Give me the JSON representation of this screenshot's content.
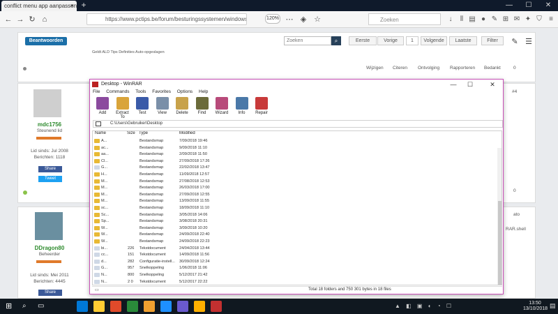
{
  "browser": {
    "tab_title": "conflict menu app aanpassen w...",
    "tab_close": "×",
    "new_tab": "+",
    "url": "https://www.pctips.be/forum/besturingssystemen/windows-8/...",
    "zoom": "120%",
    "search_placeholder": "Zoeken",
    "window_controls": [
      "—",
      "☐",
      "✕"
    ]
  },
  "forum": {
    "reply_button": "Beantwoorden",
    "search_placeholder": "Zoeken",
    "search_btn": "⌕",
    "nav": [
      "Eerste",
      "Vorige",
      "1",
      "Volgende",
      "Laatste"
    ],
    "filter": "Filter",
    "post_small_text": "Geldt ALD Tips Definities Auto-opgeslagen",
    "actions": [
      "Wijzigen",
      "Citeren",
      "Ontvolging",
      "Rapporteren",
      "Bedankt"
    ],
    "bedankt_count": "0",
    "users": [
      {
        "name": "mdc1756",
        "role": "Steunend lid",
        "since": "Lid sinds: Jul 2008",
        "posts": "Berichten: 1118",
        "share": "Share",
        "tweet": "Tweet"
      },
      {
        "name": "DDragon80",
        "role": "Beheerder",
        "since": "Lid sinds: Mei 2011",
        "posts": "Berichten: 4445",
        "share": "Share"
      }
    ],
    "post_number": "#4",
    "side_count": "0",
    "side_text_1": "ato",
    "side_text_2": "RAR.shell"
  },
  "winrar": {
    "title": "Desktop - WinRAR",
    "menu": [
      "File",
      "Commands",
      "Tools",
      "Favorites",
      "Options",
      "Help"
    ],
    "toolbar": [
      "Add",
      "Extract To",
      "Test",
      "View",
      "Delete",
      "Find",
      "Wizard",
      "Info",
      "Repair"
    ],
    "toolbar_colors": [
      "#8b4a9e",
      "#d9a43a",
      "#3a5aa8",
      "#7a8fa8",
      "#c8a24a",
      "#6b6b3a",
      "#b84a7a",
      "#4a78a8",
      "#c83a3a"
    ],
    "address": "C:\\Users\\Gebruiker\\Desktop",
    "columns": [
      "Name",
      "Size",
      "Type",
      "Modified"
    ],
    "files": [
      {
        "name": "A...",
        "size": "",
        "type": "Bestandsmap",
        "modified": "7/09/2018 19:46",
        "kind": "folder"
      },
      {
        "name": "ac...",
        "size": "",
        "type": "Bestandsmap",
        "modified": "9/09/2018 11:10",
        "kind": "folder"
      },
      {
        "name": "aa...",
        "size": "",
        "type": "Bestandsmap",
        "modified": "2/09/2018 11:50",
        "kind": "folder"
      },
      {
        "name": "Cl...",
        "size": "",
        "type": "Bestandsmap",
        "modified": "27/09/2018 17:26",
        "kind": "folder"
      },
      {
        "name": "G...",
        "size": "",
        "type": "Bestandsmap",
        "modified": "22/02/2018 13:47",
        "kind": "doc"
      },
      {
        "name": "H...",
        "size": "",
        "type": "Bestandsmap",
        "modified": "11/09/2018 12:57",
        "kind": "folder"
      },
      {
        "name": "M...",
        "size": "",
        "type": "Bestandsmap",
        "modified": "27/08/2018 12:53",
        "kind": "folder"
      },
      {
        "name": "M...",
        "size": "",
        "type": "Bestandsmap",
        "modified": "26/03/2018 17:00",
        "kind": "folder"
      },
      {
        "name": "M...",
        "size": "",
        "type": "Bestandsmap",
        "modified": "27/09/2018 12:55",
        "kind": "folder"
      },
      {
        "name": "M...",
        "size": "",
        "type": "Bestandsmap",
        "modified": "13/09/2018 11:55",
        "kind": "folder"
      },
      {
        "name": "sc...",
        "size": "",
        "type": "Bestandsmap",
        "modified": "18/09/2018 11:10",
        "kind": "folder"
      },
      {
        "name": "Sc...",
        "size": "",
        "type": "Bestandsmap",
        "modified": "3/05/2018 14:06",
        "kind": "folder"
      },
      {
        "name": "Sp...",
        "size": "",
        "type": "Bestandsmap",
        "modified": "3/08/2018 20:31",
        "kind": "folder"
      },
      {
        "name": "W...",
        "size": "",
        "type": "Bestandsmap",
        "modified": "3/09/2018 10:20",
        "kind": "folder"
      },
      {
        "name": "W...",
        "size": "",
        "type": "Bestandsmap",
        "modified": "24/09/2018 22:40",
        "kind": "folder"
      },
      {
        "name": "W...",
        "size": "",
        "type": "Bestandsmap",
        "modified": "24/09/2018 22:23",
        "kind": "folder"
      },
      {
        "name": "bi...",
        "size": "226",
        "type": "Tekstdocument",
        "modified": "24/04/2018 13:44",
        "kind": "doc"
      },
      {
        "name": "cc...",
        "size": "151",
        "type": "Tekstdocument",
        "modified": "14/09/2018 11:56",
        "kind": "doc"
      },
      {
        "name": "d...",
        "size": "282",
        "type": "Configuratie-instell...",
        "modified": "30/09/2018 12:24",
        "kind": "doc"
      },
      {
        "name": "G...",
        "size": "957",
        "type": "Snelkoppeling",
        "modified": "1/06/2018 11:06",
        "kind": "doc"
      },
      {
        "name": "N...",
        "size": "800",
        "type": "Snelkoppeling",
        "modified": "5/12/2017 21:42",
        "kind": "doc"
      },
      {
        "name": "N...",
        "size": "2 0",
        "type": "Tekstdocument",
        "modified": "5/12/2017 22:22",
        "kind": "doc"
      }
    ],
    "status": "Total 18 folders and 750 301 bytes in 18 files"
  },
  "taskbar": {
    "items": [
      "#0078d7",
      "#ffcc33",
      "#e04a2a",
      "#2a8a3a",
      "#f0a030",
      "#1e90ff",
      "#6a5acd",
      "#ffb000",
      "#c23030"
    ],
    "time": "13:50",
    "date": "13/10/2018"
  }
}
